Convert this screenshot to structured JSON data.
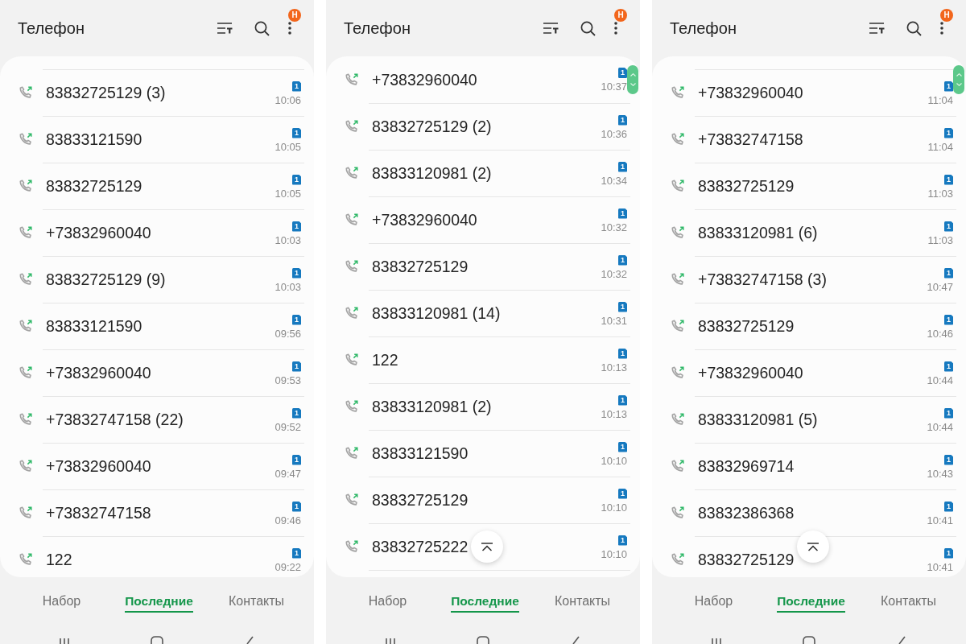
{
  "panels": [
    {
      "title": "Телефон",
      "notification_badge": "Н",
      "cut_row_above": true,
      "cut_row_below": false,
      "fast_scroller": false,
      "scroll_top_button": false,
      "calls": [
        {
          "number": "83832725129 (3)",
          "sim": "1",
          "time": "10:06"
        },
        {
          "number": "83833121590",
          "sim": "1",
          "time": "10:05"
        },
        {
          "number": "83832725129",
          "sim": "1",
          "time": "10:05"
        },
        {
          "number": "+73832960040",
          "sim": "1",
          "time": "10:03"
        },
        {
          "number": "83832725129 (9)",
          "sim": "1",
          "time": "10:03"
        },
        {
          "number": "83833121590",
          "sim": "1",
          "time": "09:56"
        },
        {
          "number": "+73832960040",
          "sim": "1",
          "time": "09:53"
        },
        {
          "number": "+73832747158 (22)",
          "sim": "1",
          "time": "09:52"
        },
        {
          "number": "+73832960040",
          "sim": "1",
          "time": "09:47"
        },
        {
          "number": "+73832747158",
          "sim": "1",
          "time": "09:46"
        },
        {
          "number": "122",
          "sim": "1",
          "time": "09:22"
        }
      ],
      "tabs": [
        {
          "label": "Набор",
          "selected": false
        },
        {
          "label": "Последние",
          "selected": true
        },
        {
          "label": "Контакты",
          "selected": false
        }
      ]
    },
    {
      "title": "Телефон",
      "notification_badge": "Н",
      "cut_row_above": false,
      "cut_row_below": true,
      "fast_scroller": true,
      "scroll_top_button": true,
      "calls": [
        {
          "number": "+73832960040",
          "sim": "1",
          "time": "10:37"
        },
        {
          "number": "83832725129 (2)",
          "sim": "1",
          "time": "10:36"
        },
        {
          "number": "83833120981 (2)",
          "sim": "1",
          "time": "10:34"
        },
        {
          "number": "+73832960040",
          "sim": "1",
          "time": "10:32"
        },
        {
          "number": "83832725129",
          "sim": "1",
          "time": "10:32"
        },
        {
          "number": "83833120981 (14)",
          "sim": "1",
          "time": "10:31"
        },
        {
          "number": "122",
          "sim": "1",
          "time": "10:13"
        },
        {
          "number": "83833120981 (2)",
          "sim": "1",
          "time": "10:13"
        },
        {
          "number": "83833121590",
          "sim": "1",
          "time": "10:10"
        },
        {
          "number": "83832725129",
          "sim": "1",
          "time": "10:10"
        },
        {
          "number": "83832725222",
          "sim": "1",
          "time": "10:10"
        }
      ],
      "tabs": [
        {
          "label": "Набор",
          "selected": false
        },
        {
          "label": "Последние",
          "selected": true
        },
        {
          "label": "Контакты",
          "selected": false
        }
      ]
    },
    {
      "title": "Телефон",
      "notification_badge": "Н",
      "cut_row_above": true,
      "cut_row_below": false,
      "fast_scroller": true,
      "scroll_top_button": true,
      "calls": [
        {
          "number": "+73832960040",
          "sim": "1",
          "time": "11:04"
        },
        {
          "number": "+73832747158",
          "sim": "1",
          "time": "11:04"
        },
        {
          "number": "83832725129",
          "sim": "1",
          "time": "11:03"
        },
        {
          "number": "83833120981 (6)",
          "sim": "1",
          "time": "11:03"
        },
        {
          "number": "+73832747158 (3)",
          "sim": "1",
          "time": "10:47"
        },
        {
          "number": "83832725129",
          "sim": "1",
          "time": "10:46"
        },
        {
          "number": "+73832960040",
          "sim": "1",
          "time": "10:44"
        },
        {
          "number": "83833120981 (5)",
          "sim": "1",
          "time": "10:44"
        },
        {
          "number": "83832969714",
          "sim": "1",
          "time": "10:43"
        },
        {
          "number": "83832386368",
          "sim": "1",
          "time": "10:41"
        },
        {
          "number": "83832725129",
          "sim": "1",
          "time": "10:41"
        }
      ],
      "tabs": [
        {
          "label": "Набор",
          "selected": false
        },
        {
          "label": "Последние",
          "selected": true
        },
        {
          "label": "Контакты",
          "selected": false
        }
      ]
    }
  ]
}
